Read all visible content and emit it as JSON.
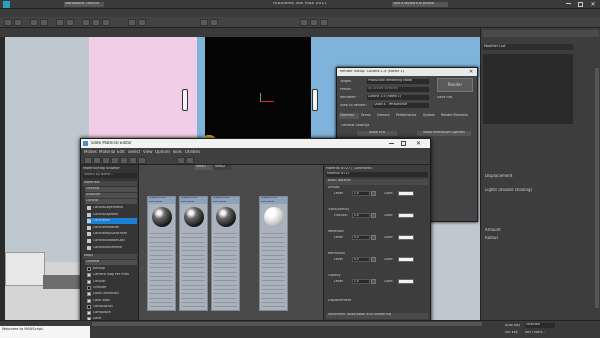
{
  "app": {
    "title": "Autodesk 3ds Max 2017",
    "workspace": "Workspace: Default",
    "search_placeholder": "Type a keyword or phrase"
  },
  "viewport": {
    "label": "[+] [Perspective] [Standard] [Default Shading]"
  },
  "render_setup": {
    "title": "Render Setup: Corona 1.5 (hotfix 1)",
    "rows": [
      {
        "label": "Target:",
        "value": "Production Rendering Mode"
      },
      {
        "label": "Preset:",
        "value": "No preset selected"
      },
      {
        "label": "Renderer:",
        "value": "Corona 1.5 (hotfix 1)"
      },
      {
        "label": "View to Render:",
        "value": "Quad 4 - Perspective"
      }
    ],
    "render_button": "Render",
    "save_file": "Save File",
    "tabs": [
      "Common",
      "Scene",
      "Camera",
      "Performance",
      "System",
      "Render Elements"
    ],
    "section": "General Settings",
    "options": [
      "Show VFB",
      "Setup Interactive LightMix"
    ]
  },
  "material_editor": {
    "title": "Slate Material Editor",
    "menu": [
      "Modes",
      "Material",
      "Edit",
      "Select",
      "View",
      "Options",
      "Tools",
      "Utilities"
    ],
    "view_tabs": [
      "View1",
      "View2"
    ],
    "browser": {
      "title": "Material/Map Browser",
      "search_placeholder": "Search by Name ...",
      "groups": [
        "Materials",
        "General",
        "Scanline",
        "Corona"
      ],
      "corona_items": [
        "CoronaLayeredMtl",
        "CoronaLightMtl",
        "CoronaMtl",
        "CoronaPortalMtl",
        "CoronaRaySwitchMtl",
        "CoronaShadowCatc",
        "CoronaVolumeMtl"
      ],
      "maps_group": "Maps",
      "maps_sub": "General",
      "map_items": [
        "Bitmap",
        "Camera Map Per Pixel",
        "Cellular",
        "Checker",
        "ColorCorrection",
        "Color Map",
        "Combustion",
        "Composite",
        "Dent",
        "Falloff",
        "Gradient"
      ]
    },
    "nodes": [
      {
        "title": "Material #20",
        "sub": "CoronaMtl",
        "ball": "dark"
      },
      {
        "title": "Material #21",
        "sub": "CoronaMtl",
        "ball": "dark"
      },
      {
        "title": "Material #22",
        "sub": "CoronaMtl",
        "ball": "dark"
      },
      {
        "title": "Material #23",
        "sub": "CoronaMtl",
        "ball": "light"
      },
      {
        "title": "Material #24",
        "sub": "CoronaMtl",
        "ball": "light"
      },
      {
        "title": "Material #25",
        "sub": "CoronaMtl",
        "ball": "light"
      }
    ],
    "params": {
      "header": "Material #727 ( CoronaMtl )",
      "name": "Material #727",
      "basic_options": "Basic options",
      "rows": [
        {
          "section": "Diffuse",
          "level_label": "Level:",
          "level": "1,0"
        },
        {
          "section": "Translucency",
          "level_label": "Fraction:",
          "level": "0,0"
        },
        {
          "section": "Reflection",
          "level_label": "Level:",
          "level": "0,0"
        },
        {
          "section": "Refraction",
          "level_label": "Level:",
          "level": "0,0"
        },
        {
          "section": "Opacity",
          "level_label": "Level:",
          "level": "1,0"
        }
      ],
      "color_label": "Color:",
      "glossiness_label": "Glossiness:",
      "fresnel_label": "Fresnel IOR:",
      "ior_label": "IOR:",
      "displacement": "Displacement",
      "rollouts": [
        "Volumetric absorption and scattering",
        "Advanced options",
        "Maps"
      ],
      "maps_cols": [
        "Amount",
        "Map"
      ],
      "maps_rows": [
        "Diffuse",
        "Reflection"
      ]
    }
  },
  "command_panel": {
    "modifier_list": "Modifier List",
    "items": [
      "Displacement",
      "Lights (double shading)",
      "Amount",
      "Radius"
    ]
  },
  "status": {
    "maxscript": "Welcome to MAXScript.",
    "auto_key": "Auto Key",
    "selected": "Selected",
    "set_key": "Set Key",
    "key_filters": "Key Filters..."
  },
  "colors": {
    "accent_blue": "#1e7fd6",
    "wall_pink": "#f1cde8",
    "wall_blue": "#7fb3da"
  }
}
